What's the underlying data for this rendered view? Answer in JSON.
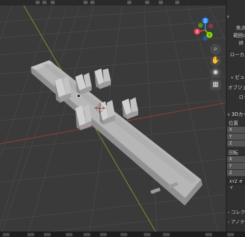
{
  "gizmo": {
    "z_label": "Z",
    "y_label": "Y",
    "x_label": "X"
  },
  "nav_tools": {
    "zoom": "zoom-icon",
    "pan": "hand-icon",
    "camera": "camera-icon",
    "grid": "grid-icon"
  },
  "panel": {
    "view_rows": [
      "焦点距",
      "範囲の開",
      "終",
      "ローカルカ"
    ],
    "view_section": "ビュ",
    "view_section_rows": [
      "オブジェク",
      "ロッ"
    ],
    "cursor_section": "3Dカー",
    "location_label": "位置",
    "location_axes": [
      "X",
      "Y",
      "Z"
    ],
    "rotation_label": "回転",
    "rotation_axes": [
      "X",
      "Y",
      "Z"
    ],
    "rotation_mode": "XYZ オイ",
    "collections_section": "コレク",
    "annotations_section": "アノテ"
  },
  "colors": {
    "x_axis": "#e8434f",
    "y_axis": "#8bdc00",
    "z_axis": "#2c8fff",
    "grid_line": "#474747",
    "mesh_top": "#b6b6b6",
    "mesh_side": "#8e8e8e"
  }
}
